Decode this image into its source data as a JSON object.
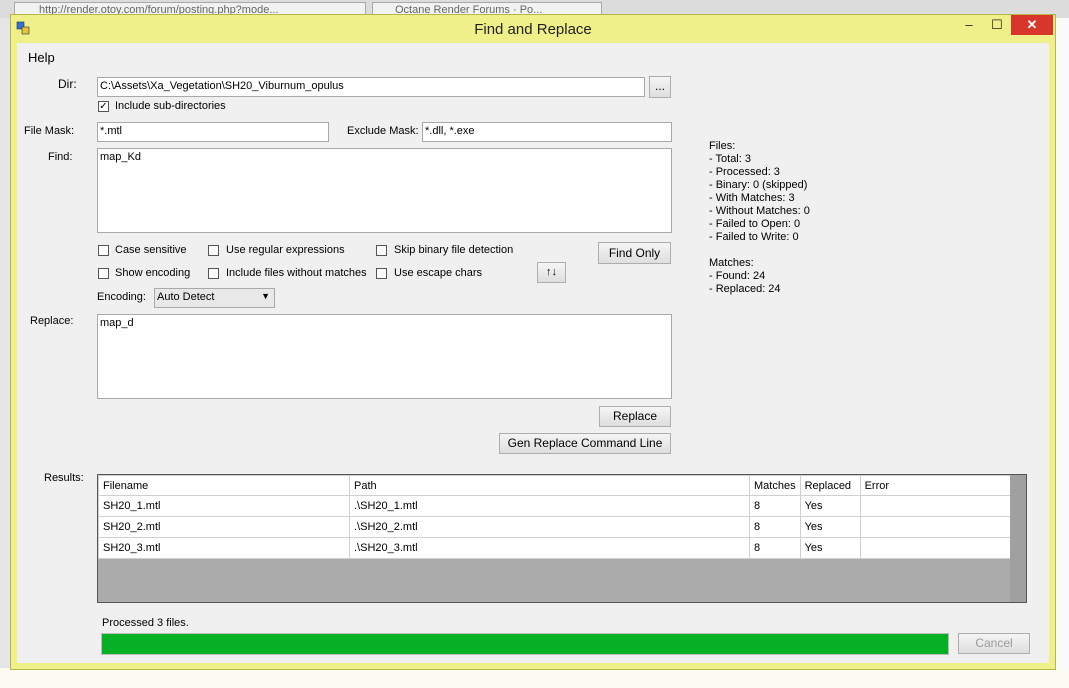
{
  "browser": {
    "tab1_text": "http://render.otoy.com/forum/posting.php?mode...",
    "tab2_text": "Octane Render Forums · Po..."
  },
  "window": {
    "title": "Find and Replace",
    "controls": {
      "minimize": "–",
      "maximize": "☐",
      "close": "✕"
    }
  },
  "menu": {
    "help": "Help"
  },
  "form": {
    "dir_label": "Dir:",
    "dir_value": "C:\\Assets\\Xa_Vegetation\\SH20_Viburnum_opulus",
    "browse_label": "...",
    "include_subdirs_label": "Include sub-directories",
    "include_subdirs_checked": true,
    "file_mask_label": "File Mask:",
    "file_mask_value": "*.mtl",
    "exclude_mask_label": "Exclude Mask:",
    "exclude_mask_value": "*.dll, *.exe",
    "find_label": "Find:",
    "find_value": "map_Kd",
    "options": {
      "case_sensitive": "Case sensitive",
      "use_regex": "Use regular expressions",
      "skip_binary": "Skip binary file detection",
      "show_encoding": "Show encoding",
      "include_no_matches": "Include files without matches",
      "use_escape": "Use escape chars"
    },
    "find_only_label": "Find Only",
    "swap_label": "↑↓",
    "encoding_label": "Encoding:",
    "encoding_value": "Auto Detect",
    "replace_label": "Replace:",
    "replace_value": "map_d",
    "replace_button": "Replace",
    "gen_cmd_button": "Gen Replace Command Line"
  },
  "stats": {
    "files_header": "Files:",
    "total": "- Total: 3",
    "processed": "- Processed: 3",
    "binary": "- Binary: 0 (skipped)",
    "with_matches": "- With Matches: 3",
    "without_matches": "- Without Matches: 0",
    "failed_open": "- Failed to Open: 0",
    "failed_write": "- Failed to Write: 0",
    "matches_header": "Matches:",
    "found": "- Found: 24",
    "replaced": "- Replaced: 24"
  },
  "results": {
    "label": "Results:",
    "columns": [
      "Filename",
      "Path",
      "Matches",
      "Replaced",
      "Error"
    ],
    "rows": [
      [
        "SH20_1.mtl",
        ".\\SH20_1.mtl",
        "8",
        "Yes",
        ""
      ],
      [
        "SH20_2.mtl",
        ".\\SH20_2.mtl",
        "8",
        "Yes",
        ""
      ],
      [
        "SH20_3.mtl",
        ".\\SH20_3.mtl",
        "8",
        "Yes",
        ""
      ]
    ]
  },
  "status": {
    "text": "Processed 3 files.",
    "progress_fraction": 1.0,
    "progress_color": "#06b025",
    "cancel_label": "Cancel"
  },
  "colors": {
    "window_frame": "#f0f08a",
    "close_button": "#d9362b"
  }
}
